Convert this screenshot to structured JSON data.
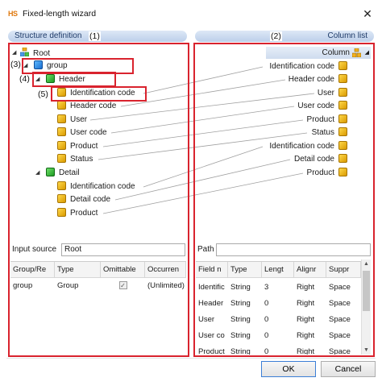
{
  "window": {
    "title": "Fixed-length wizard",
    "app_icon_text": "HS",
    "close_glyph": "✕"
  },
  "panes": {
    "left_header": "Structure definition",
    "right_header": "Column list"
  },
  "callouts": [
    "(1)",
    "(2)",
    "(3)",
    "(4)",
    "(5)"
  ],
  "tree": {
    "root": "Root",
    "group": "group",
    "header": "Header",
    "header_children": [
      "Identification code",
      "Header code",
      "User",
      "User code",
      "Product",
      "Status"
    ],
    "detail": "Detail",
    "detail_children": [
      "Identification code",
      "Detail code",
      "Product"
    ]
  },
  "column_list": {
    "header_label": "Column",
    "items": [
      "Identification code",
      "Header code",
      "User",
      "User code",
      "Product",
      "Status",
      "Identification code",
      "Detail code",
      "Product"
    ]
  },
  "input_source": {
    "label": "Input source",
    "value": "Root"
  },
  "path": {
    "label": "Path",
    "value": ""
  },
  "left_grid": {
    "columns": [
      "Group/Re",
      "Type",
      "Omittable",
      "Occurren"
    ],
    "rows": [
      {
        "name": "group",
        "type": "Group",
        "omittable": "✓",
        "occurrence": "(Unlimited)"
      }
    ]
  },
  "right_grid": {
    "columns": [
      "Field n",
      "Type",
      "Lengt",
      "Alignr",
      "Suppr"
    ],
    "rows": [
      [
        "Identific",
        "String",
        "3",
        "Right",
        "Space"
      ],
      [
        "Header",
        "String",
        "0",
        "Right",
        "Space"
      ],
      [
        "User",
        "String",
        "0",
        "Right",
        "Space"
      ],
      [
        "User co",
        "String",
        "0",
        "Right",
        "Space"
      ],
      [
        "Product",
        "String",
        "0",
        "Right",
        "Space"
      ]
    ]
  },
  "buttons": {
    "ok": "OK",
    "cancel": "Cancel"
  },
  "colors": {
    "callout_red": "#d9232e",
    "header_blue": "#bccfea",
    "ok_border": "#3c7fd6"
  }
}
